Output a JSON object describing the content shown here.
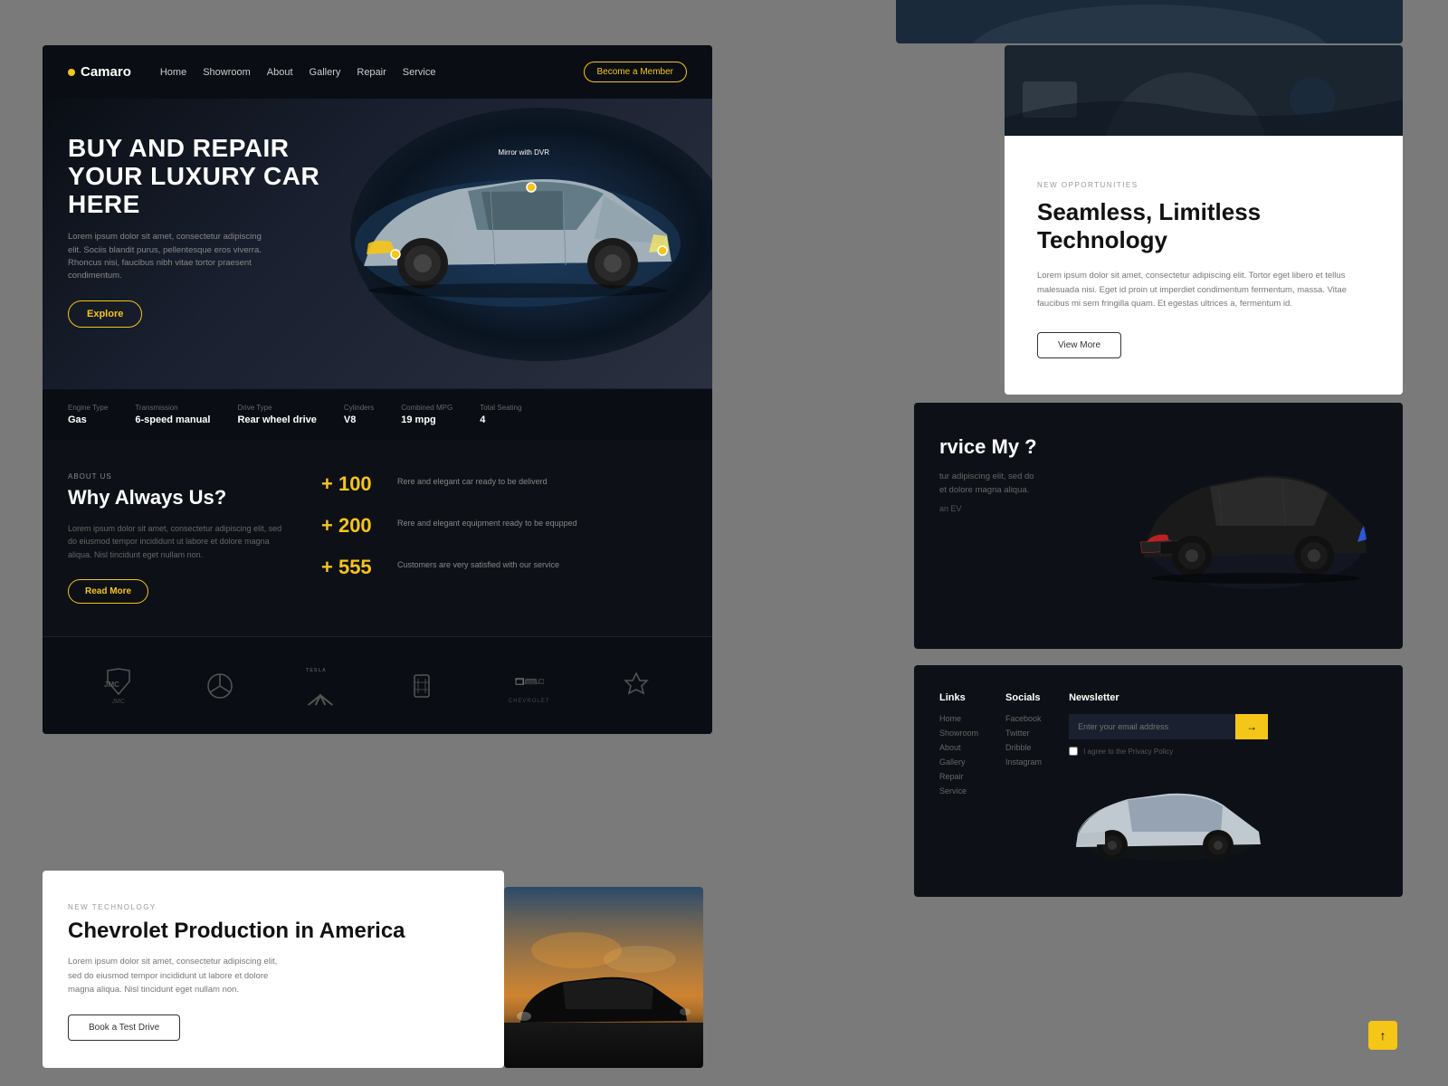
{
  "site": {
    "logo": "Camaro",
    "logo_dot_color": "#f5c518"
  },
  "nav": {
    "links": [
      "Home",
      "Showroom",
      "About",
      "Gallery",
      "Repair",
      "Service"
    ],
    "cta_label": "Become a Member"
  },
  "hero": {
    "title": "BUY AND REPAIR YOUR LUXURY CAR HERE",
    "description": "Lorem ipsum dolor sit amet, consectetur adipiscing elit. Sociis blandit purus, pellentesque eros viverra. Rhoncus nisi, faucibus nibh vitae tortor praesent condimentum.",
    "cta_label": "Explore",
    "mirror_label": "Mirror with DVR",
    "specs": [
      {
        "label": "Engine Type",
        "value": "Gas"
      },
      {
        "label": "Transmission",
        "value": "6-speed manual"
      },
      {
        "label": "Drive Type",
        "value": "Rear wheel drive"
      },
      {
        "label": "Cylinders",
        "value": "V8"
      },
      {
        "label": "Combined MPG",
        "value": "19 mpg"
      },
      {
        "label": "Total Seating",
        "value": "4"
      }
    ]
  },
  "about": {
    "tag": "ABOUT US",
    "title": "Why Always Us?",
    "description": "Lorem ipsum dolor sit amet, consectetur adipiscing elit, sed do eiusmod tempor incididunt ut labore et dolore magna aliqua. Nisl tincidunt eget nullam non.",
    "cta_label": "Read More",
    "stats": [
      {
        "number": "+ 100",
        "description": "Rere and elegant car ready to be deliverd"
      },
      {
        "number": "+ 200",
        "description": "Rere and elegant equipment ready to be equpped"
      },
      {
        "number": "+ 555",
        "description": "Customers are very satisfied with our service"
      }
    ]
  },
  "brands": [
    "JMC",
    "Mercedes",
    "TESLA",
    "Ferrari",
    "CHEVROLET",
    "Mitsubishi"
  ],
  "right_white": {
    "tag": "NEW OPPORTUNITIES",
    "title": "Seamless, Limitless Technology",
    "description": "Lorem ipsum dolor sit amet, consectetur adipiscing elit. Tortor eget libero et tellus malesuada nisi. Eget id proin ut imperdiet condimentum fermentum, massa. Vitae faucibus mi sem fringilla quam. Et egestas ultrices a, fermentum id.",
    "cta_label": "View More"
  },
  "mid_right": {
    "title": "rvice My ?",
    "description": "tur adipiscing elit, sed do et dolore magna aliqua.",
    "note": "an EV"
  },
  "footer": {
    "links_title": "Links",
    "links": [
      "Home",
      "Showroom",
      "About",
      "Gallery",
      "Repair",
      "Service"
    ],
    "socials_title": "Socials",
    "socials": [
      "Facebook",
      "Twitter",
      "Dribble",
      "Instagram"
    ],
    "newsletter_title": "Newsletter",
    "newsletter_placeholder": "Enter your email address",
    "newsletter_checkbox_label": "I agree to the Privacy Policy"
  },
  "bottom_left": {
    "tag": "NEW TECHNOLOGY",
    "title": "Chevrolet  Production in America",
    "description": "Lorem ipsum dolor sit amet, consectetur adipiscing elit, sed do eiusmod tempor incididunt ut labore et dolore magna aliqua. Nisl tincidunt eget nullam non.",
    "cta_label": "Book a Test Drive"
  },
  "bleed": {
    "title": "rvice My",
    "subtitle": "tur adipiscing elit, sed do et dolore magna aliqua.",
    "note": "an EV"
  }
}
